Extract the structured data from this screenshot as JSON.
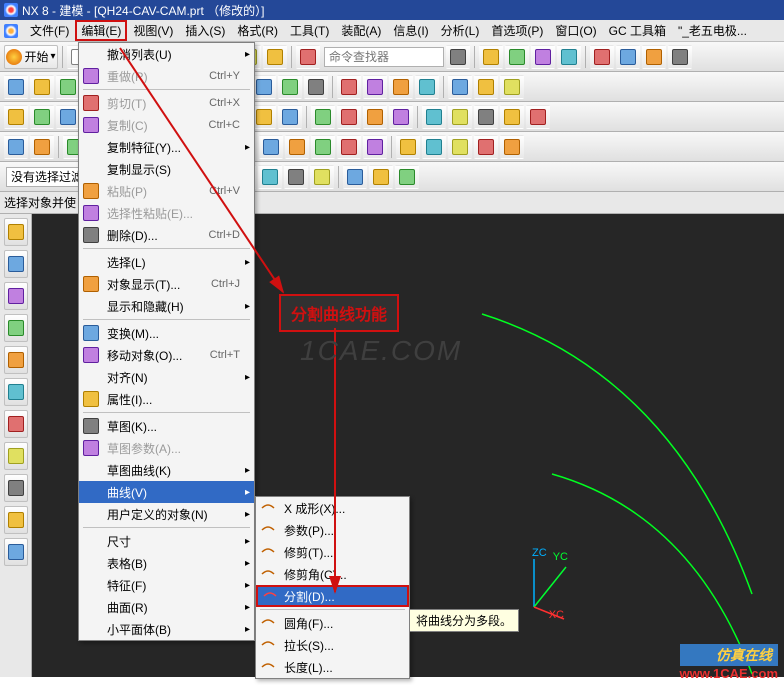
{
  "title": "NX 8 - 建模 - [QH24-CAV-CAM.prt （修改的）]",
  "menubar": [
    "文件(F)",
    "编辑(E)",
    "视图(V)",
    "插入(S)",
    "格式(R)",
    "工具(T)",
    "装配(A)",
    "信息(I)",
    "分析(L)",
    "首选项(P)",
    "窗口(O)",
    "GC 工具箱",
    "\"_老五电极..."
  ],
  "start_label": "开始",
  "cmd_finder": "命令查找器",
  "filter_hint": "没有选择过滤",
  "prompt_text": "选择对象并使",
  "edit_menu": [
    {
      "t": "sub",
      "label": "撤消列表(U)",
      "enabled": true
    },
    {
      "t": "item",
      "label": "重做(R)",
      "sc": "Ctrl+Y",
      "enabled": false,
      "icon": "redo"
    },
    {
      "t": "sep"
    },
    {
      "t": "item",
      "label": "剪切(T)",
      "sc": "Ctrl+X",
      "enabled": false,
      "icon": "cut"
    },
    {
      "t": "item",
      "label": "复制(C)",
      "sc": "Ctrl+C",
      "enabled": false,
      "icon": "copy"
    },
    {
      "t": "sub",
      "label": "复制特征(Y)...",
      "enabled": true
    },
    {
      "t": "item",
      "label": "复制显示(S)",
      "enabled": true
    },
    {
      "t": "item",
      "label": "粘贴(P)",
      "sc": "Ctrl+V",
      "enabled": false,
      "icon": "paste"
    },
    {
      "t": "item",
      "label": "选择性粘贴(E)...",
      "enabled": false,
      "icon": "paste-special"
    },
    {
      "t": "item",
      "label": "删除(D)...",
      "sc": "Ctrl+D",
      "enabled": true,
      "icon": "delete"
    },
    {
      "t": "sep"
    },
    {
      "t": "sub",
      "label": "选择(L)",
      "enabled": true
    },
    {
      "t": "item",
      "label": "对象显示(T)...",
      "sc": "Ctrl+J",
      "enabled": true,
      "icon": "object-display"
    },
    {
      "t": "sub",
      "label": "显示和隐藏(H)",
      "enabled": true
    },
    {
      "t": "sep"
    },
    {
      "t": "item",
      "label": "变换(M)...",
      "enabled": true,
      "icon": "transform"
    },
    {
      "t": "item",
      "label": "移动对象(O)...",
      "sc": "Ctrl+T",
      "enabled": true,
      "icon": "move"
    },
    {
      "t": "sub",
      "label": "对齐(N)",
      "enabled": true
    },
    {
      "t": "item",
      "label": "属性(I)...",
      "enabled": true,
      "icon": "properties"
    },
    {
      "t": "sep"
    },
    {
      "t": "item",
      "label": "草图(K)...",
      "enabled": true,
      "icon": "sketch"
    },
    {
      "t": "item",
      "label": "草图参数(A)...",
      "enabled": false,
      "icon": "sketch-params"
    },
    {
      "t": "sub",
      "label": "草图曲线(K)",
      "enabled": true
    },
    {
      "t": "sub",
      "label": "曲线(V)",
      "enabled": true,
      "highlight": true
    },
    {
      "t": "sub",
      "label": "用户定义的对象(N)",
      "enabled": true
    },
    {
      "t": "sep"
    },
    {
      "t": "sub",
      "label": "尺寸",
      "enabled": true
    },
    {
      "t": "sub",
      "label": "表格(B)",
      "enabled": true
    },
    {
      "t": "sub",
      "label": "特征(F)",
      "enabled": true
    },
    {
      "t": "sub",
      "label": "曲面(R)",
      "enabled": true
    },
    {
      "t": "sub",
      "label": "小平面体(B)",
      "enabled": true
    }
  ],
  "curve_submenu": [
    {
      "label": "X 成形(X)...",
      "icon": "xform"
    },
    {
      "label": "参数(P)...",
      "icon": "params"
    },
    {
      "label": "修剪(T)...",
      "icon": "trim"
    },
    {
      "label": "修剪角(C)...",
      "icon": "trim-corner"
    },
    {
      "label": "分割(D)...",
      "icon": "divide",
      "highlight": true
    },
    {
      "t": "sep"
    },
    {
      "label": "圆角(F)...",
      "icon": "fillet"
    },
    {
      "label": "拉长(S)...",
      "icon": "stretch"
    },
    {
      "label": "长度(L)...",
      "icon": "length"
    }
  ],
  "tooltip": "将曲线分为多段。",
  "annotation": "分割曲线功能",
  "watermark1": "1CAE.COM",
  "watermark2_l1": "仿真在线",
  "watermark2_l2": "www.1CAE.com",
  "triad": {
    "x": "XC",
    "y": "YC",
    "z": "ZC"
  }
}
